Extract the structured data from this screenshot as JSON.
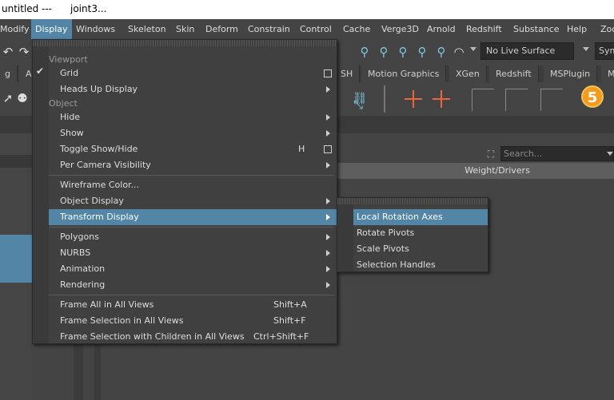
{
  "titlebar": {
    "file": "untitled",
    "sep": "---",
    "item": "joint3..."
  },
  "menubar": [
    "Modify",
    "Display",
    "Windows",
    "Skeleton",
    "Skin",
    "Deform",
    "Constrain",
    "Control",
    "Cache",
    "Verge3D",
    "Arnold",
    "Redshift",
    "Substance",
    "Help",
    "Zoo"
  ],
  "toolbar": {
    "live_surface": "No Live Surface",
    "symmetry": "Sym"
  },
  "shelf_tabs": [
    "g",
    "A",
    "SH",
    "Motion Graphics",
    "XGen",
    "Redshift",
    "MSPlugin",
    "M"
  ],
  "badge": "5",
  "search": {
    "placeholder": "Search..."
  },
  "panel": {
    "header": "Weight/Drivers"
  },
  "display_menu": {
    "sections": {
      "viewport": "Viewport",
      "object": "Object"
    },
    "items": [
      {
        "label": "Grid",
        "checked_mark": "✔"
      },
      {
        "label": "Heads Up Display"
      },
      {
        "label": "Hide"
      },
      {
        "label": "Show"
      },
      {
        "label": "Toggle Show/Hide",
        "shortcut": "H"
      },
      {
        "label": "Per Camera Visibility"
      },
      {
        "label": "Wireframe Color..."
      },
      {
        "label": "Object Display"
      },
      {
        "label": "Transform Display"
      },
      {
        "label": "Polygons"
      },
      {
        "label": "NURBS"
      },
      {
        "label": "Animation"
      },
      {
        "label": "Rendering"
      },
      {
        "label": "Frame All in All Views",
        "shortcut": "Shift+A"
      },
      {
        "label": "Frame Selection in All Views",
        "shortcut": "Shift+F"
      },
      {
        "label": "Frame Selection with Children in All Views",
        "shortcut": "Ctrl+Shift+F"
      }
    ]
  },
  "transform_submenu": {
    "items": [
      {
        "label": "Local Rotation Axes"
      },
      {
        "label": "Rotate Pivots"
      },
      {
        "label": "Scale Pivots"
      },
      {
        "label": "Selection Handles"
      }
    ]
  },
  "colors": {
    "highlight": "#5285a6",
    "menu_bg": "#404040",
    "joint_orange": "#e8683a",
    "badge_orange": "#f29b1c"
  }
}
